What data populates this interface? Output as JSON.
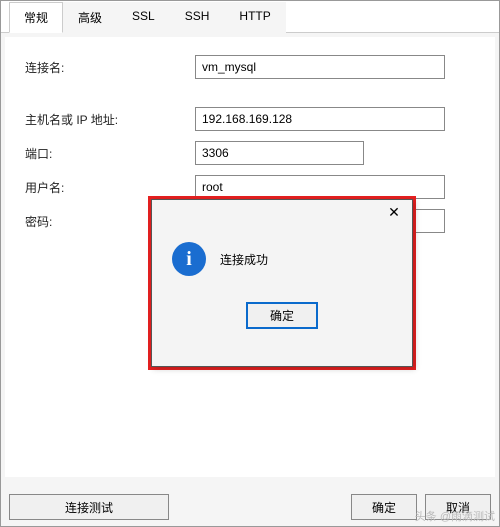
{
  "tabs": {
    "general": "常规",
    "advanced": "高级",
    "ssl": "SSL",
    "ssh": "SSH",
    "http": "HTTP"
  },
  "form": {
    "conn_name_label": "连接名:",
    "conn_name_value": "vm_mysql",
    "host_label": "主机名或 IP 地址:",
    "host_value": "192.168.169.128",
    "port_label": "端口:",
    "port_value": "3306",
    "user_label": "用户名:",
    "user_value": "root",
    "pass_label": "密码:",
    "pass_value": "•••••••"
  },
  "buttons": {
    "test": "连接测试",
    "ok": "确定",
    "cancel": "取消"
  },
  "dialog": {
    "message": "连接成功",
    "ok": "确定",
    "close": "✕"
  },
  "watermark": "头条 @雨滴测试"
}
